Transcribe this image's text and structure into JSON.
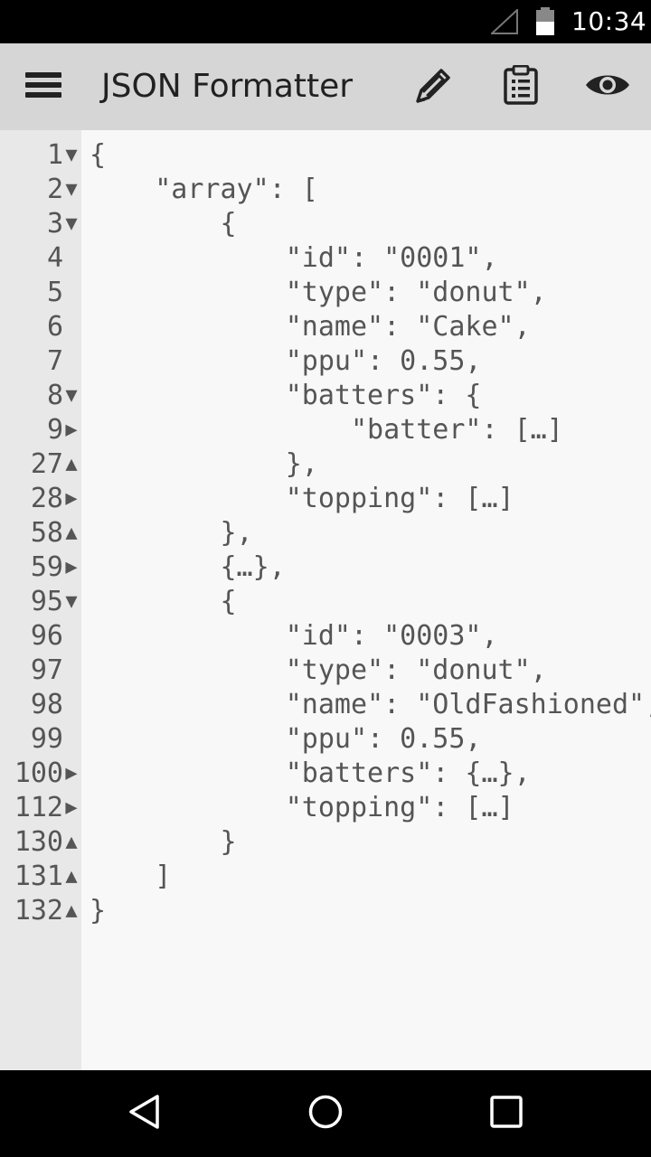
{
  "status_bar": {
    "time": "10:34",
    "icons": [
      "signal-icon",
      "battery-icon"
    ]
  },
  "app_bar": {
    "title": "JSON Formatter",
    "actions": [
      "menu-icon",
      "edit-icon",
      "clipboard-icon",
      "eye-icon"
    ]
  },
  "editor": {
    "lines": [
      {
        "num": "1",
        "fold": "▼",
        "code": "{"
      },
      {
        "num": "2",
        "fold": "▼",
        "code": "    \"array\": ["
      },
      {
        "num": "3",
        "fold": "▼",
        "code": "        {"
      },
      {
        "num": "4",
        "fold": "",
        "code": "            \"id\": \"0001\","
      },
      {
        "num": "5",
        "fold": "",
        "code": "            \"type\": \"donut\","
      },
      {
        "num": "6",
        "fold": "",
        "code": "            \"name\": \"Cake\","
      },
      {
        "num": "7",
        "fold": "",
        "code": "            \"ppu\": 0.55,"
      },
      {
        "num": "8",
        "fold": "▼",
        "code": "            \"batters\": {"
      },
      {
        "num": "9",
        "fold": "▶",
        "code": "                \"batter\": […]"
      },
      {
        "num": "27",
        "fold": "▲",
        "code": "            },"
      },
      {
        "num": "28",
        "fold": "▶",
        "code": "            \"topping\": […]"
      },
      {
        "num": "58",
        "fold": "▲",
        "code": "        },"
      },
      {
        "num": "59",
        "fold": "▶",
        "code": "        {…},"
      },
      {
        "num": "95",
        "fold": "▼",
        "code": "        {"
      },
      {
        "num": "96",
        "fold": "",
        "code": "            \"id\": \"0003\","
      },
      {
        "num": "97",
        "fold": "",
        "code": "            \"type\": \"donut\","
      },
      {
        "num": "98",
        "fold": "",
        "code": "            \"name\": \"OldFashioned\","
      },
      {
        "num": "99",
        "fold": "",
        "code": "            \"ppu\": 0.55,"
      },
      {
        "num": "100",
        "fold": "▶",
        "code": "            \"batters\": {…},"
      },
      {
        "num": "112",
        "fold": "▶",
        "code": "            \"topping\": […]"
      },
      {
        "num": "130",
        "fold": "▲",
        "code": "        }"
      },
      {
        "num": "131",
        "fold": "▲",
        "code": "    ]"
      },
      {
        "num": "132",
        "fold": "▲",
        "code": "}"
      }
    ]
  },
  "nav_bar": {
    "icons": [
      "back-icon",
      "home-icon",
      "recents-icon"
    ]
  }
}
